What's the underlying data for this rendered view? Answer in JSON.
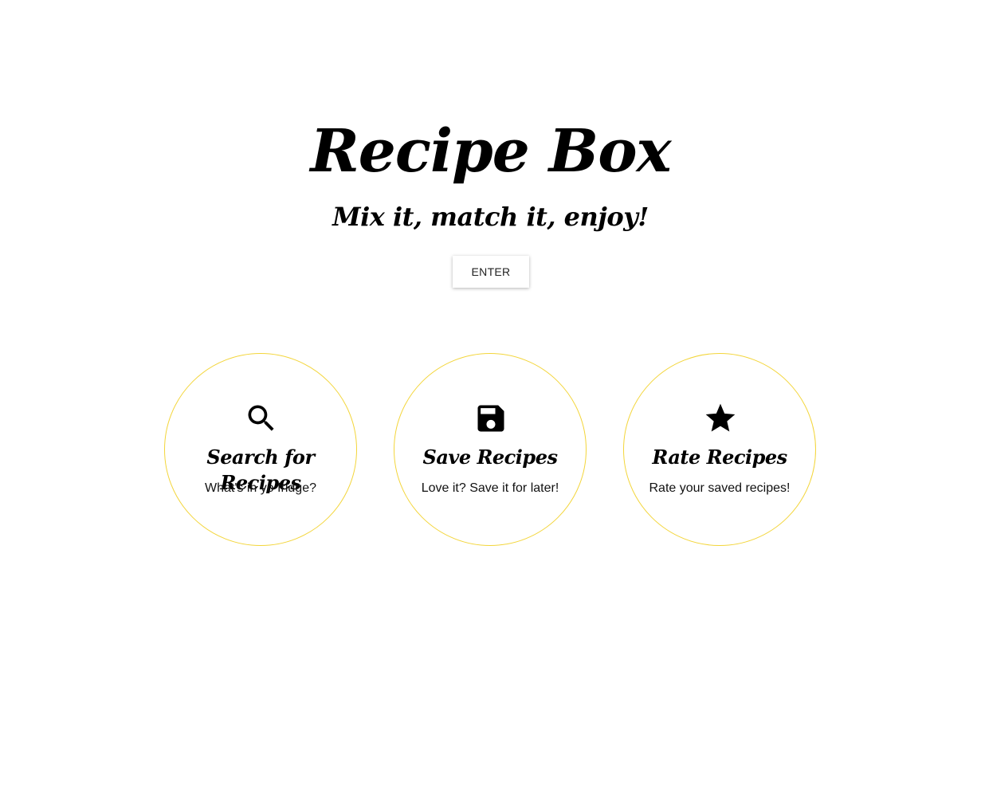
{
  "hero": {
    "title": "Recipe Box",
    "subtitle": "Mix it, match it, enjoy!",
    "enter_label": "ENTER"
  },
  "features": [
    {
      "icon": "search-icon",
      "title": "Search for Recipes",
      "description": "What's in yo fridge?"
    },
    {
      "icon": "floppy-disk-icon",
      "title": "Save Recipes",
      "description": "Love it? Save it for later!"
    },
    {
      "icon": "star-icon",
      "title": "Rate Recipes",
      "description": "Rate your saved recipes!"
    }
  ],
  "colors": {
    "circle_border": "#f3d53a",
    "text": "#000000",
    "background": "#ffffff"
  }
}
